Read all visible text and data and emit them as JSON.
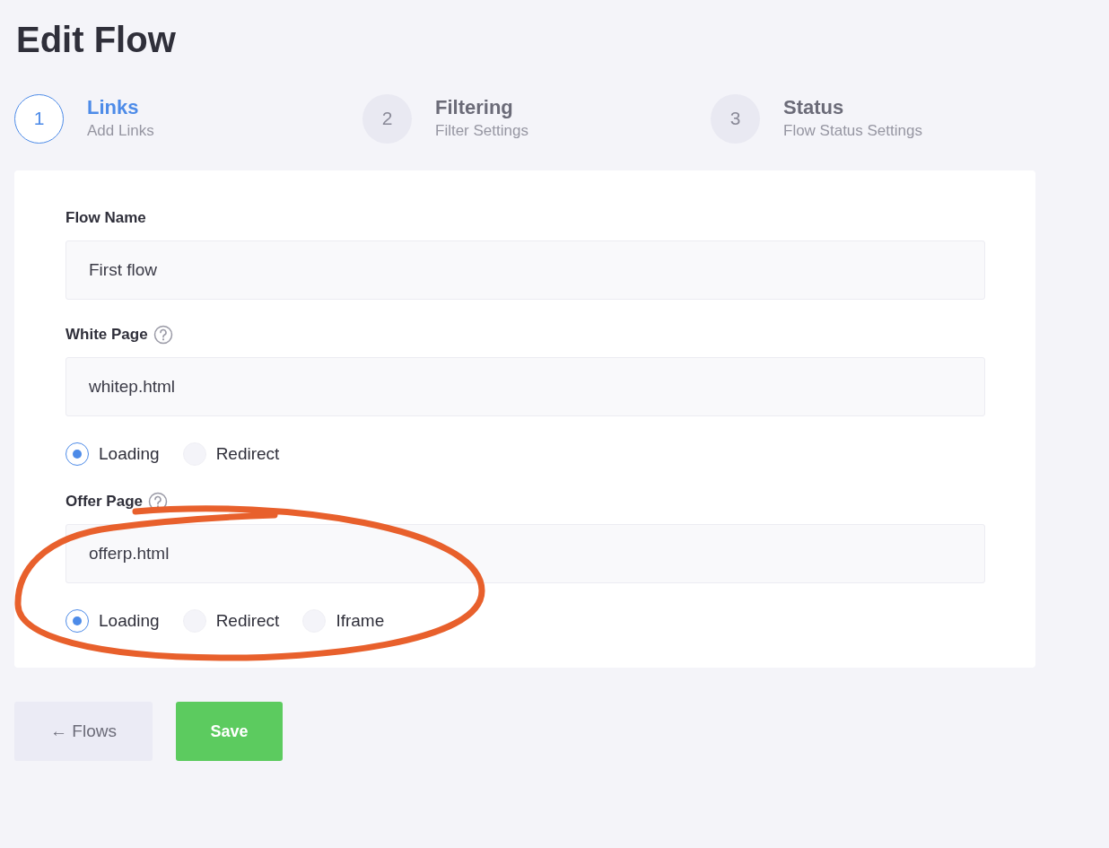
{
  "title": "Edit Flow",
  "steps": [
    {
      "number": "1",
      "title": "Links",
      "subtitle": "Add Links",
      "selected": true
    },
    {
      "number": "2",
      "title": "Filtering",
      "subtitle": "Filter Settings",
      "selected": false
    },
    {
      "number": "3",
      "title": "Status",
      "subtitle": "Flow Status Settings",
      "selected": false
    }
  ],
  "fields": [
    {
      "label": "Flow Name",
      "help": false,
      "value": "First flow"
    },
    {
      "label": "White Page",
      "help": true,
      "value": "whitep.html",
      "circled": false,
      "options": [
        {
          "label": "Loading",
          "selected": true
        },
        {
          "label": "Redirect",
          "selected": false
        }
      ]
    },
    {
      "label": "Offer Page",
      "help": true,
      "value": "offerp.html",
      "circled": true,
      "options": [
        {
          "label": "Loading",
          "selected": true
        },
        {
          "label": "Redirect",
          "selected": false
        },
        {
          "label": "Iframe",
          "selected": false
        }
      ]
    }
  ],
  "buttons": [
    {
      "label": "← Flows",
      "kind": "secondary"
    },
    {
      "label": "Save",
      "kind": "primary"
    }
  ]
}
